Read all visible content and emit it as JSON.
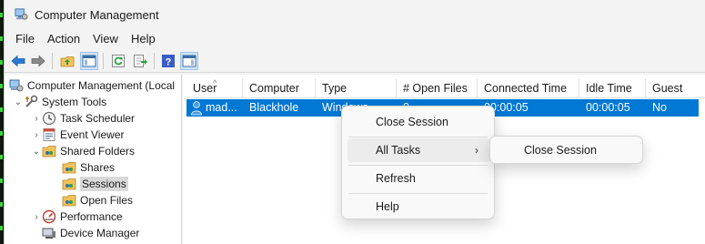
{
  "window": {
    "title": "Computer Management",
    "app_icon": "computer-management-icon"
  },
  "menu": [
    "File",
    "Action",
    "View",
    "Help"
  ],
  "toolbar": {
    "buttons": [
      {
        "icon": "back-arrow-icon",
        "color": "#2a7bd4"
      },
      {
        "icon": "forward-arrow-icon",
        "color": "#707070"
      },
      {
        "icon": "up-folder-icon",
        "color": "#e0a533"
      },
      {
        "icon": "show-hide-console-tree-icon",
        "color": "#3a6ea5"
      },
      {
        "icon": "refresh-icon",
        "color": "#2e9e44"
      },
      {
        "icon": "export-list-icon",
        "color": "#2e9e44"
      },
      {
        "icon": "help-icon",
        "color": "#3a5bc7"
      },
      {
        "icon": "show-action-pane-icon",
        "color": "#3a6ea5"
      }
    ]
  },
  "tree": {
    "items": [
      {
        "label": "Computer Management (Local",
        "icon": "computer-management-icon",
        "expander": "",
        "selected": false
      },
      {
        "label": "System Tools",
        "icon": "system-tools-icon",
        "expander": "open",
        "selected": false
      },
      {
        "label": "Task Scheduler",
        "icon": "clock-icon",
        "expander": "closed",
        "selected": false
      },
      {
        "label": "Event Viewer",
        "icon": "event-viewer-icon",
        "expander": "closed",
        "selected": false
      },
      {
        "label": "Shared Folders",
        "icon": "shared-folder-icon",
        "expander": "open",
        "selected": false
      },
      {
        "label": "Shares",
        "icon": "shared-folder-icon",
        "expander": "",
        "selected": false
      },
      {
        "label": "Sessions",
        "icon": "shared-folder-icon",
        "expander": "",
        "selected": true
      },
      {
        "label": "Open Files",
        "icon": "shared-folder-icon",
        "expander": "",
        "selected": false
      },
      {
        "label": "Performance",
        "icon": "performance-icon",
        "expander": "closed",
        "selected": false
      },
      {
        "label": "Device Manager",
        "icon": "device-manager-icon",
        "expander": "",
        "selected": false
      }
    ]
  },
  "sessions": {
    "columns": [
      "User",
      "Computer",
      "Type",
      "# Open Files",
      "Connected Time",
      "Idle Time",
      "Guest"
    ],
    "sorted_column": "User",
    "rows": [
      {
        "user": "mad...",
        "computer": "Blackhole",
        "type": "Windows",
        "open_files": "0",
        "connected_time": "00:00:05",
        "idle_time": "00:00:05",
        "guest": "No",
        "icon": "user-icon",
        "selected": true
      }
    ],
    "selection_color": "#0078d4"
  },
  "context_menu": {
    "items": [
      "Close Session",
      "All Tasks",
      "Refresh",
      "Help"
    ],
    "highlighted": "All Tasks",
    "submenu_arrow_icon": "chevron-right-icon"
  },
  "submenu": {
    "items": [
      "Close Session"
    ]
  }
}
